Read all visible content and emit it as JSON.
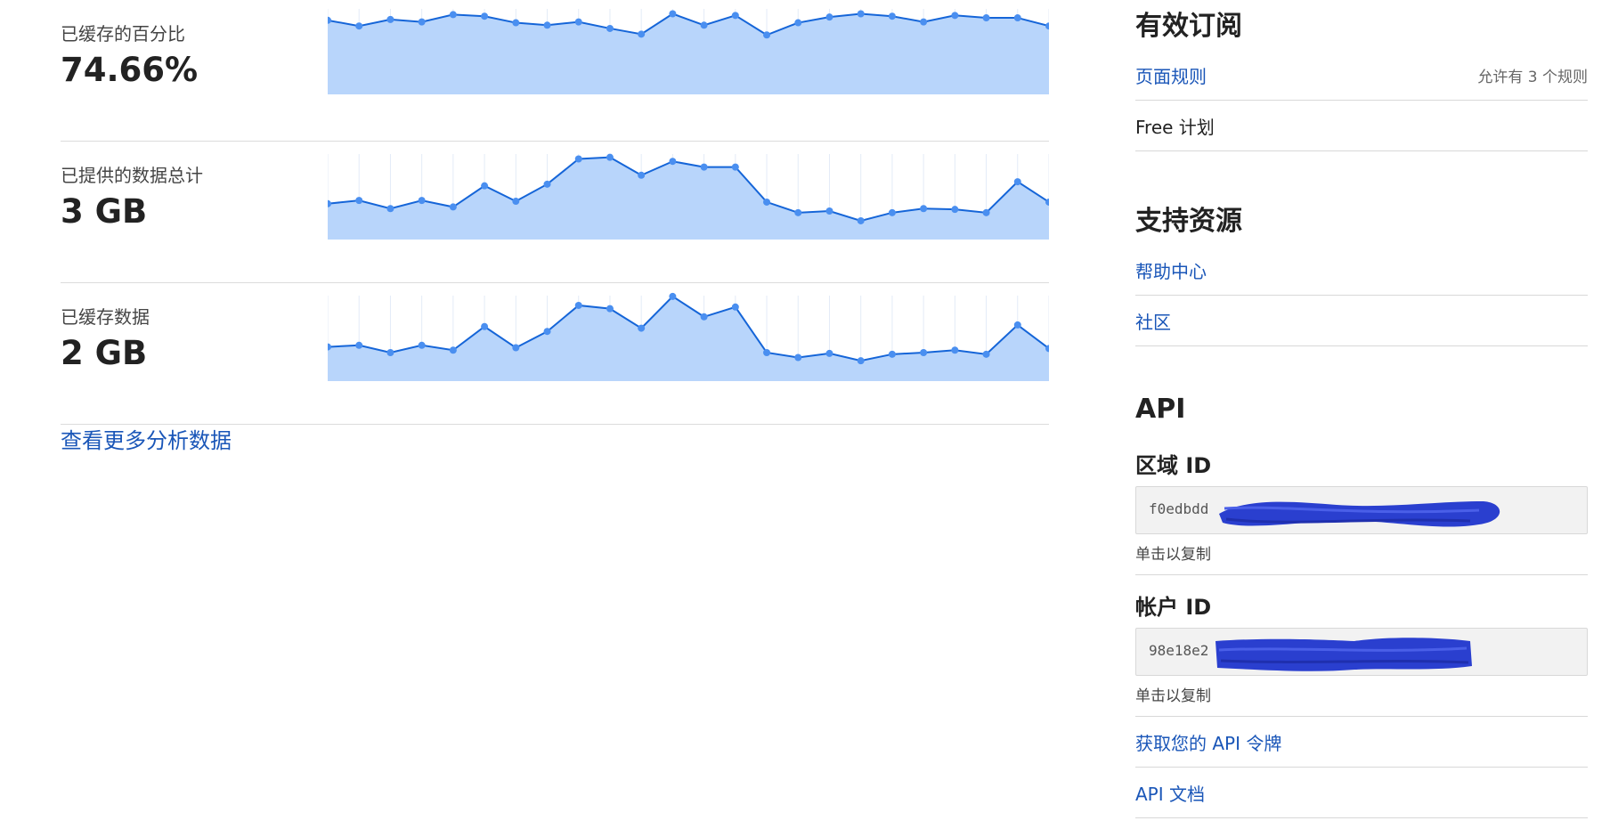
{
  "analytics": {
    "metrics": [
      {
        "label": "已缓存的百分比",
        "value": "74.66%",
        "values": [
          91,
          84,
          92,
          89,
          98,
          96,
          88,
          85,
          89,
          81,
          74,
          99,
          85,
          97,
          73,
          88,
          95,
          99,
          96,
          89,
          97,
          94,
          94,
          84
        ]
      },
      {
        "label": "已提供的数据总计",
        "value": "3 GB",
        "values": [
          44,
          48,
          38,
          48,
          40,
          66,
          47,
          68,
          99,
          101,
          79,
          96,
          89,
          89,
          46,
          33,
          35,
          23,
          33,
          38,
          37,
          33,
          71,
          46
        ]
      },
      {
        "label": "已缓存数据",
        "value": "2 GB",
        "values": [
          42,
          44,
          35,
          44,
          38,
          67,
          41,
          61,
          93,
          89,
          65,
          104,
          79,
          91,
          35,
          29,
          34,
          25,
          33,
          35,
          38,
          33,
          69,
          40
        ]
      }
    ],
    "more_link": "查看更多分析数据",
    "accent_color": "#1a56b8",
    "line_color": "#1565d8",
    "fill_color": "#b8d5fb",
    "point_color": "#4a8ff0"
  },
  "sidebar": {
    "subscriptions": {
      "title": "有效订阅",
      "items": [
        {
          "label": "页面规则",
          "note": "允许有 3 个规则"
        },
        {
          "label": "Free 计划"
        }
      ]
    },
    "support": {
      "title": "支持资源",
      "items": [
        {
          "label": "帮助中心"
        },
        {
          "label": "社区"
        }
      ]
    },
    "api": {
      "title": "API",
      "zone_label": "区域 ID",
      "zone_value": "f0edbdd",
      "account_label": "帐户 ID",
      "account_value": "98e18e2",
      "copy_hint": "单击以复制",
      "links": [
        {
          "label": "获取您的 API 令牌"
        },
        {
          "label": "API 文档"
        }
      ]
    }
  }
}
